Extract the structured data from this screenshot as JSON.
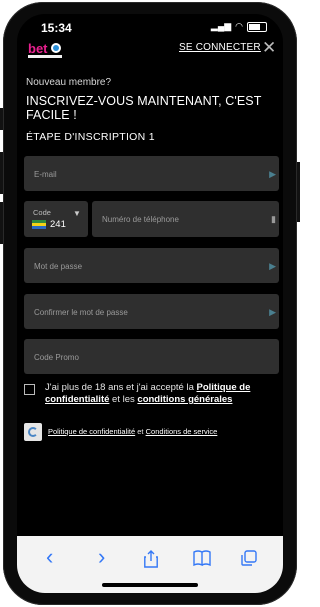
{
  "status_bar": {
    "time": "15:34"
  },
  "header": {
    "logo_text": "bet",
    "login_label": "SE CONNECTER",
    "close_label": "✕"
  },
  "form": {
    "new_member": "Nouveau membre?",
    "headline": "INSCRIVEZ-VOUS MAINTENANT, C'EST FACILE !",
    "step_label": "ÉTAPE D'INSCRIPTION 1",
    "email_placeholder": "E-mail",
    "code_label": "Code",
    "country_code": "241",
    "phone_placeholder": "Numéro de téléphone",
    "password_placeholder": "Mot de passe",
    "confirm_password_placeholder": "Confirmer le mot de passe",
    "promo_placeholder": "Code Promo",
    "agree_prefix": "J'ai plus de 18 ans et j'ai accepté la",
    "agree_privacy_link": "Politique de confidentialité",
    "agree_and": "et les",
    "agree_terms_link": "conditions générales",
    "privacy_policy_link": "Politique de confidentialité",
    "privacy_and": "et",
    "terms_of_service_link": "Conditions de service"
  },
  "browser": {
    "back_icon": "‹",
    "forward_icon": "›"
  },
  "colors": {
    "background": "#000000",
    "field": "#2f2f2f",
    "browser_accent": "#3478f6"
  }
}
